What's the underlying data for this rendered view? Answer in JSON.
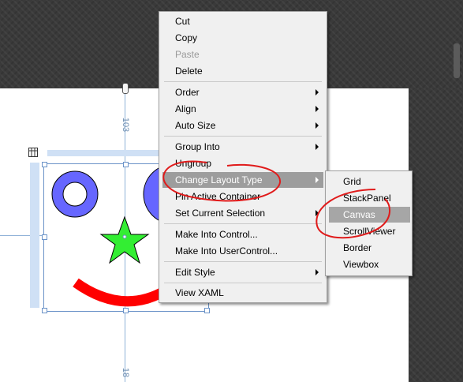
{
  "context_menu": {
    "items": [
      {
        "label": "Cut",
        "enabled": true,
        "has_submenu": false
      },
      {
        "label": "Copy",
        "enabled": true,
        "has_submenu": false
      },
      {
        "label": "Paste",
        "enabled": false,
        "has_submenu": false
      },
      {
        "label": "Delete",
        "enabled": true,
        "has_submenu": false
      },
      {
        "label": "Order",
        "enabled": true,
        "has_submenu": true
      },
      {
        "label": "Align",
        "enabled": true,
        "has_submenu": true
      },
      {
        "label": "Auto Size",
        "enabled": true,
        "has_submenu": true
      },
      {
        "label": "Group Into",
        "enabled": true,
        "has_submenu": true
      },
      {
        "label": "Ungroup",
        "enabled": true,
        "has_submenu": false
      },
      {
        "label": "Change Layout Type",
        "enabled": true,
        "has_submenu": true,
        "highlighted": true
      },
      {
        "label": "Pin Active Container",
        "enabled": true,
        "has_submenu": false
      },
      {
        "label": "Set Current Selection",
        "enabled": true,
        "has_submenu": true
      },
      {
        "label": "Make Into Control...",
        "enabled": true,
        "has_submenu": false
      },
      {
        "label": "Make Into UserControl...",
        "enabled": true,
        "has_submenu": false
      },
      {
        "label": "Edit Style",
        "enabled": true,
        "has_submenu": true
      },
      {
        "label": "View XAML",
        "enabled": true,
        "has_submenu": false
      }
    ]
  },
  "layout_submenu": {
    "items": [
      {
        "label": "Grid"
      },
      {
        "label": "StackPanel"
      },
      {
        "label": "Canvas",
        "highlighted": true
      },
      {
        "label": "ScrollViewer"
      },
      {
        "label": "Border"
      },
      {
        "label": "Viewbox"
      }
    ]
  },
  "design_surface": {
    "top_margin_label": "103",
    "bottom_margin_label": "18"
  },
  "colors": {
    "menu_background": "#f0f0f0",
    "menu_highlight": "#9d9d9d",
    "annotation_red": "#e01b1b",
    "eye_blue": "#6666ff",
    "star_green": "#33ee33",
    "smile_red": "#ff0000",
    "selection_blue": "#6b93c8"
  },
  "icons": [
    "submenu-arrow-icon",
    "pin-icon",
    "grid-adorner-icon"
  ]
}
